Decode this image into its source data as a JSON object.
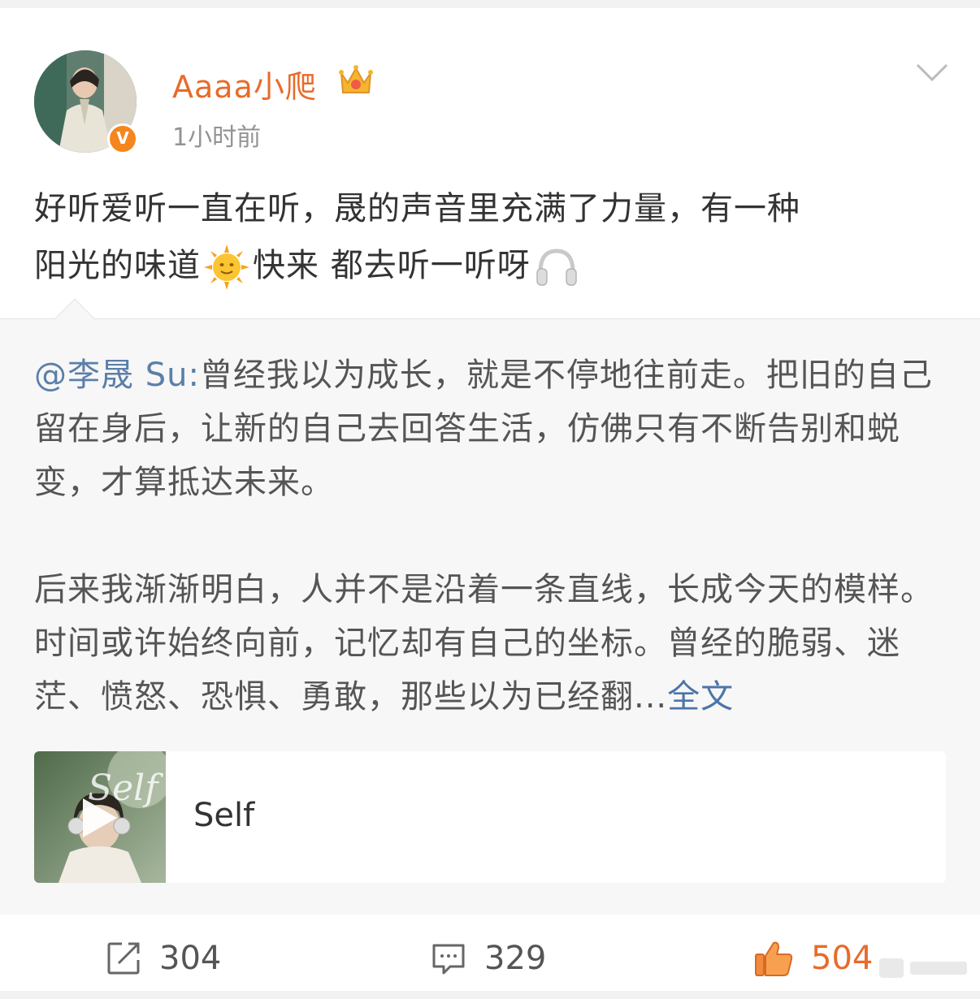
{
  "author": {
    "name": "Aaaa小爬",
    "time": "1小时前",
    "verified_badge": "V"
  },
  "post": {
    "line1": "好听爱听一直在听，晟的声音里充满了力量，有一种",
    "line2_a": "阳光的味道",
    "line2_b": "快来 都去听一听呀",
    "emojis": [
      "sun-face-icon",
      "headphones-icon"
    ]
  },
  "repost": {
    "mention": "@李晟 Su:",
    "para1": "曾经我以为成长，就是不停地往前走。把旧的自己留在身后，让新的自己去回答生活，仿佛只有不断告别和蜕变，才算抵达未来。",
    "para2": "后来我渐渐明白，人并不是沿着一条直线，长成今天的模样。时间或许始终向前，记忆却有自己的坐标。曾经的脆弱、迷茫、愤怒、恐惧、勇敢，那些以为已经翻...",
    "more": "全文",
    "music": {
      "title": "Self",
      "cover_text": "Self"
    }
  },
  "actions": {
    "reposts": "304",
    "comments": "329",
    "likes": "504"
  },
  "colors": {
    "name": "#e86b2a",
    "mention": "#5b7fa8",
    "more_link": "#4c75a8",
    "like": "#e86b2a"
  }
}
